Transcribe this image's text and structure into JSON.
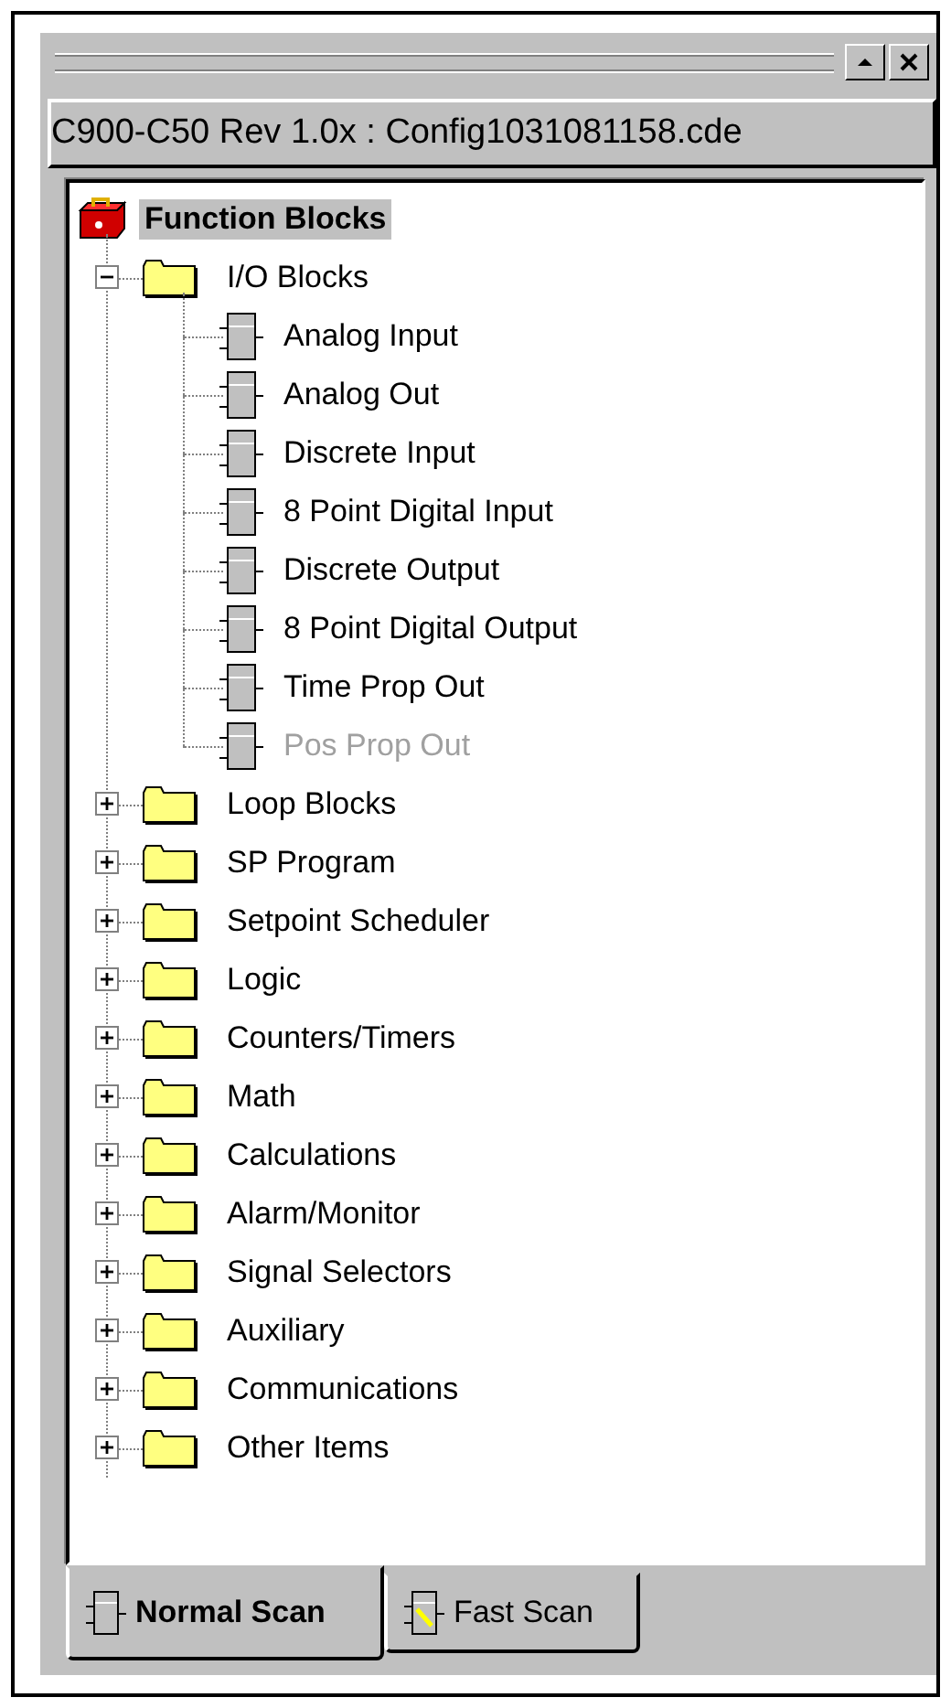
{
  "header": {
    "title": "C900-C50 Rev 1.0x : Config1031081158.cde"
  },
  "tree": {
    "label": "Function Blocks",
    "selected": true,
    "children": [
      {
        "label": "I/O Blocks",
        "expanded": true,
        "children": [
          {
            "label": "Analog Input",
            "disabled": false
          },
          {
            "label": "Analog Out",
            "disabled": false
          },
          {
            "label": "Discrete Input",
            "disabled": false
          },
          {
            "label": "8 Point Digital Input",
            "disabled": false
          },
          {
            "label": "Discrete Output",
            "disabled": false
          },
          {
            "label": "8 Point Digital Output",
            "disabled": false
          },
          {
            "label": "Time Prop Out",
            "disabled": false
          },
          {
            "label": "Pos Prop Out",
            "disabled": true
          }
        ]
      },
      {
        "label": "Loop Blocks",
        "expanded": false
      },
      {
        "label": "SP Program",
        "expanded": false
      },
      {
        "label": "Setpoint Scheduler",
        "expanded": false
      },
      {
        "label": "Logic",
        "expanded": false
      },
      {
        "label": "Counters/Timers",
        "expanded": false
      },
      {
        "label": "Math",
        "expanded": false
      },
      {
        "label": "Calculations",
        "expanded": false
      },
      {
        "label": "Alarm/Monitor",
        "expanded": false
      },
      {
        "label": "Signal Selectors",
        "expanded": false
      },
      {
        "label": "Auxiliary",
        "expanded": false
      },
      {
        "label": "Communications",
        "expanded": false
      },
      {
        "label": "Other Items",
        "expanded": false
      }
    ]
  },
  "tabs": [
    {
      "label": "Normal Scan",
      "selected": true,
      "kind": "normal"
    },
    {
      "label": "Fast Scan",
      "selected": false,
      "kind": "fast"
    }
  ]
}
